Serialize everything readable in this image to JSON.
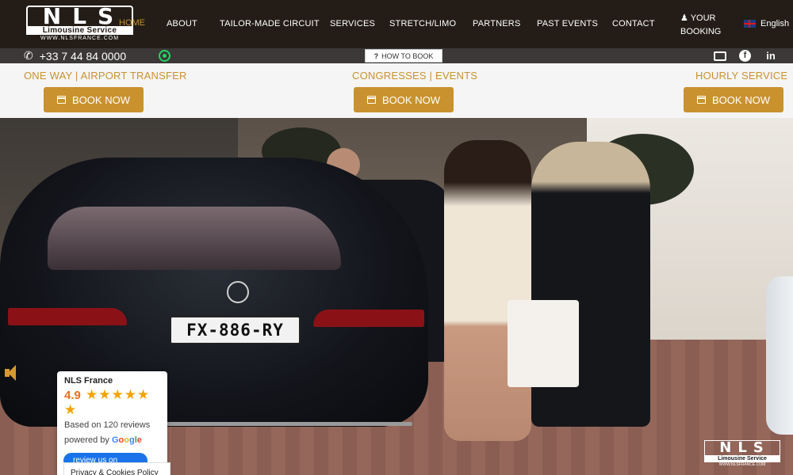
{
  "brand": {
    "logo_text": "NLS",
    "logo_subtitle": "Limousine Service",
    "logo_url": "WWW.NLSFRANCE.COM",
    "colors": {
      "gold": "#c9922e",
      "nav_bg": "#241d17",
      "bar_bg": "#3b3837"
    }
  },
  "nav": {
    "home": "HOME",
    "items": [
      "ABOUT",
      "TAILOR-MADE CIRCUIT",
      "SERVICES",
      "STRETCH/LIMO",
      "PARTNERS",
      "PAST EVENTS",
      "CONTACT"
    ],
    "booking_line1": "YOUR",
    "booking_line2": "BOOKING",
    "language": "English"
  },
  "contact": {
    "phone": "+33 7 44 84 0000",
    "how_to_book": "HOW TO BOOK",
    "icons": [
      "phone-icon",
      "whatsapp-icon",
      "mail-icon",
      "facebook-icon",
      "linkedin-icon"
    ]
  },
  "services": [
    {
      "label": "ONE WAY | AIRPORT TRANSFER",
      "button": "BOOK NOW"
    },
    {
      "label": "CONGRESSES | EVENTS",
      "button": "BOOK NOW"
    },
    {
      "label": "HOURLY SERVICE",
      "button": "BOOK NOW"
    }
  ],
  "hero": {
    "plate": "FX-886-RY"
  },
  "review": {
    "name": "NLS France",
    "rating": "4.9",
    "stars": "★★★★★",
    "half_star": "★",
    "count": "Based on 120 reviews",
    "powered": "powered by",
    "google": [
      "G",
      "o",
      "o",
      "g",
      "l",
      "e"
    ],
    "button": "review us on"
  },
  "cookie": "Privacy & Cookies Policy"
}
